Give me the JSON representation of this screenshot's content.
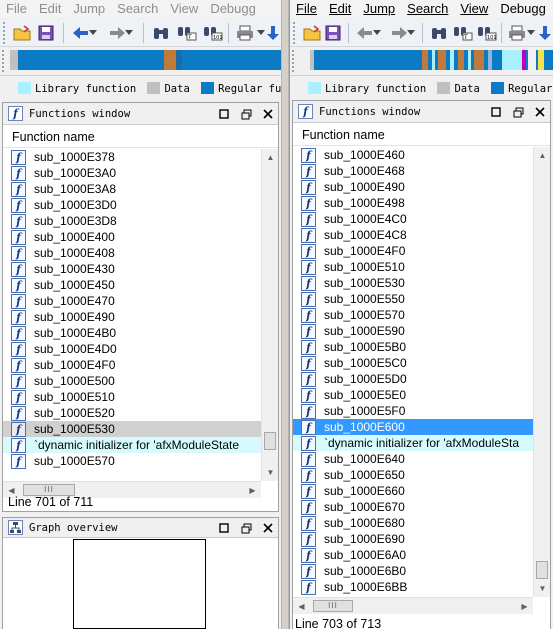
{
  "menu": {
    "file": "File",
    "edit": "Edit",
    "jump": "Jump",
    "search": "Search",
    "view": "View",
    "debugger": "Debugg"
  },
  "legend": {
    "library": "Library function",
    "data": "Data",
    "regular": "Regular function",
    "library_color": "#a9f0ff",
    "data_color": "#c0c0c0",
    "regular_color": "#0a7bc4"
  },
  "left": {
    "functions_title": "Functions window",
    "column_header": "Function name",
    "rows": [
      {
        "name": "sub_1000E378",
        "type": "regular"
      },
      {
        "name": "sub_1000E3A0",
        "type": "regular"
      },
      {
        "name": "sub_1000E3A8",
        "type": "regular"
      },
      {
        "name": "sub_1000E3D0",
        "type": "regular"
      },
      {
        "name": "sub_1000E3D8",
        "type": "regular"
      },
      {
        "name": "sub_1000E400",
        "type": "regular"
      },
      {
        "name": "sub_1000E408",
        "type": "regular"
      },
      {
        "name": "sub_1000E430",
        "type": "regular"
      },
      {
        "name": "sub_1000E450",
        "type": "regular"
      },
      {
        "name": "sub_1000E470",
        "type": "regular"
      },
      {
        "name": "sub_1000E490",
        "type": "regular"
      },
      {
        "name": "sub_1000E4B0",
        "type": "regular"
      },
      {
        "name": "sub_1000E4D0",
        "type": "regular"
      },
      {
        "name": "sub_1000E4F0",
        "type": "regular"
      },
      {
        "name": "sub_1000E500",
        "type": "regular"
      },
      {
        "name": "sub_1000E510",
        "type": "regular"
      },
      {
        "name": "sub_1000E520",
        "type": "regular"
      },
      {
        "name": "sub_1000E530",
        "type": "highlighted"
      },
      {
        "name": "`dynamic initializer for 'afxModuleState",
        "type": "library"
      },
      {
        "name": "sub_1000E570",
        "type": "regular"
      }
    ],
    "status": "Line 701 of 711",
    "graph_title": "Graph overview"
  },
  "right": {
    "functions_title": "Functions window",
    "column_header": "Function name",
    "rows": [
      {
        "name": "sub_1000E460",
        "type": "regular"
      },
      {
        "name": "sub_1000E468",
        "type": "regular"
      },
      {
        "name": "sub_1000E490",
        "type": "regular"
      },
      {
        "name": "sub_1000E498",
        "type": "regular"
      },
      {
        "name": "sub_1000E4C0",
        "type": "regular"
      },
      {
        "name": "sub_1000E4C8",
        "type": "regular"
      },
      {
        "name": "sub_1000E4F0",
        "type": "regular"
      },
      {
        "name": "sub_1000E510",
        "type": "regular"
      },
      {
        "name": "sub_1000E530",
        "type": "regular"
      },
      {
        "name": "sub_1000E550",
        "type": "regular"
      },
      {
        "name": "sub_1000E570",
        "type": "regular"
      },
      {
        "name": "sub_1000E590",
        "type": "regular"
      },
      {
        "name": "sub_1000E5B0",
        "type": "regular"
      },
      {
        "name": "sub_1000E5C0",
        "type": "regular"
      },
      {
        "name": "sub_1000E5D0",
        "type": "regular"
      },
      {
        "name": "sub_1000E5E0",
        "type": "regular"
      },
      {
        "name": "sub_1000E5F0",
        "type": "regular"
      },
      {
        "name": "sub_1000E600",
        "type": "selected"
      },
      {
        "name": "`dynamic initializer for 'afxModuleSta",
        "type": "library"
      },
      {
        "name": "sub_1000E640",
        "type": "regular"
      },
      {
        "name": "sub_1000E650",
        "type": "regular"
      },
      {
        "name": "sub_1000E660",
        "type": "regular"
      },
      {
        "name": "sub_1000E670",
        "type": "regular"
      },
      {
        "name": "sub_1000E680",
        "type": "regular"
      },
      {
        "name": "sub_1000E690",
        "type": "regular"
      },
      {
        "name": "sub_1000E6A0",
        "type": "regular"
      },
      {
        "name": "sub_1000E6B0",
        "type": "regular"
      },
      {
        "name": "sub_1000E6BB",
        "type": "regular"
      }
    ],
    "status": "Line 703 of 713"
  }
}
